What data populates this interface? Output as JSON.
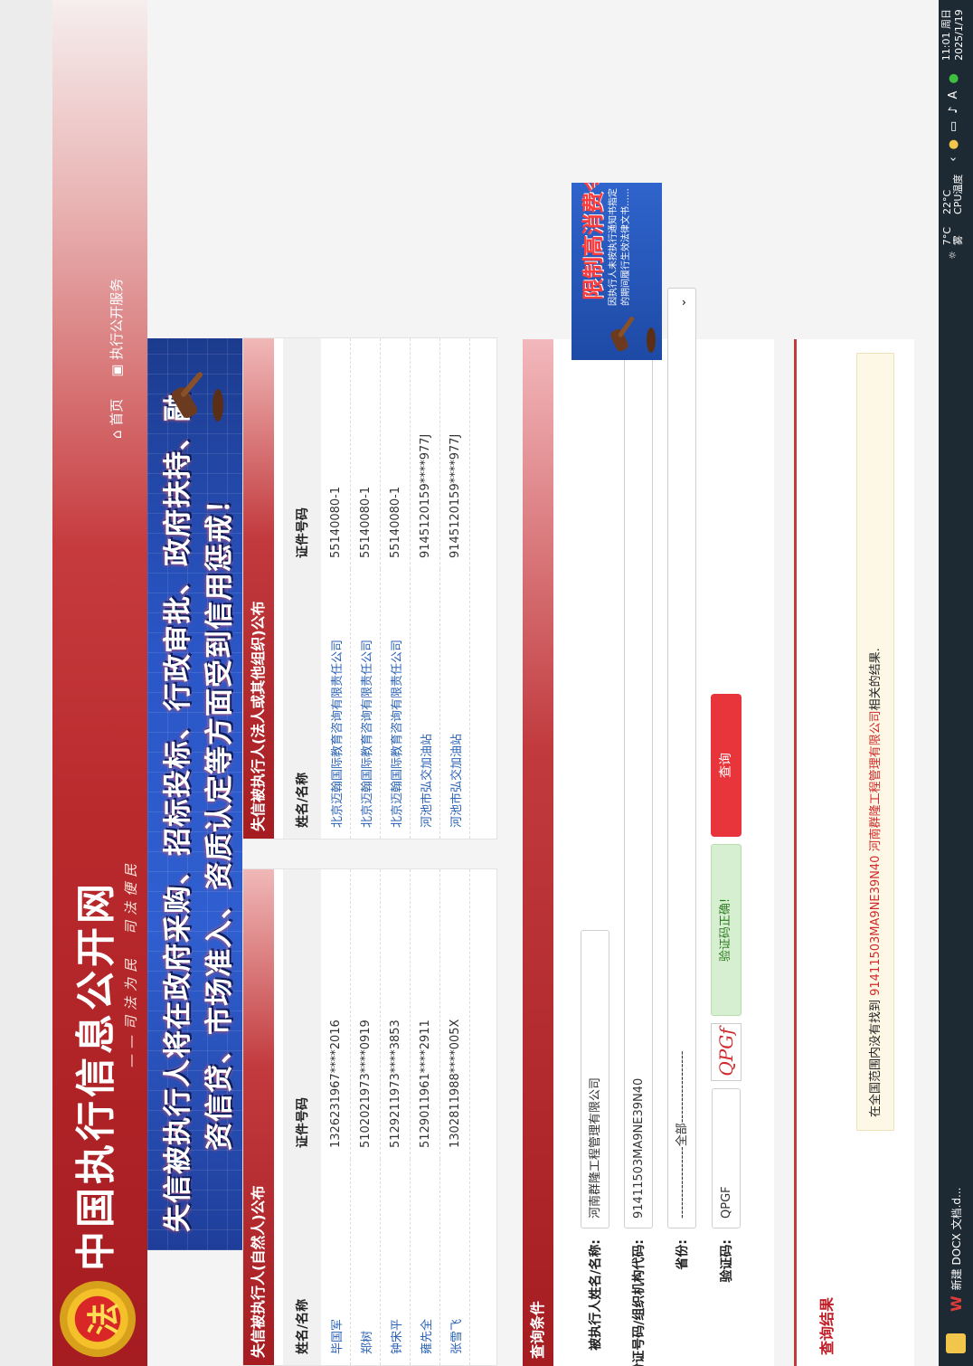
{
  "header": {
    "site_title": "中国执行信息公开网",
    "slogan": "——司法为民　司法便民",
    "nav": {
      "home": "首页",
      "service": "执行公开服务"
    }
  },
  "banner": {
    "line1": "失信被执行人将在政府采购、招标投标、行政审批、政府扶持、融",
    "line2": "资信贷、市场准入、资质认定等方面受到信用惩戒！"
  },
  "person_list": {
    "title": "失信被执行人(自然人)公布",
    "col_name": "姓名/名称",
    "col_id": "证件号码",
    "rows": [
      {
        "name": "毕国军",
        "id": "1326231967****2016"
      },
      {
        "name": "郑树",
        "id": "5102021973****0919"
      },
      {
        "name": "钟宋平",
        "id": "5129211973****3853"
      },
      {
        "name": "雍先全",
        "id": "5129011961****2911"
      },
      {
        "name": "张雪飞",
        "id": "1302811988****005X"
      }
    ]
  },
  "org_list": {
    "title": "失信被执行人(法人或其他组织)公布",
    "col_name": "姓名/名称",
    "col_id": "证件号码",
    "rows": [
      {
        "name": "北京迈翰国际教育咨询有限责任公司",
        "id": "55140080-1"
      },
      {
        "name": "北京迈翰国际教育咨询有限责任公司",
        "id": "55140080-1"
      },
      {
        "name": "北京迈翰国际教育咨询有限责任公司",
        "id": "55140080-1"
      },
      {
        "name": "河池市弘交加油站",
        "id": "9145120159****977J"
      },
      {
        "name": "河池市弘交加油站",
        "id": "9145120159****977J"
      }
    ]
  },
  "query": {
    "title": "查询条件",
    "name_label": "被执行人姓名/名称:",
    "name_value": "河南群隆工程管理有限公司",
    "id_label": "身份证号码/组织机构代码:",
    "id_value": "91411503MA9NE39N40",
    "province_label": "省份:",
    "province_value": "-----------------全部-----------------",
    "captcha_label": "验证码:",
    "captcha_value": "QPGF",
    "captcha_image_text": "QPGf",
    "captcha_ok": "验证码正确!",
    "submit": "查询"
  },
  "result": {
    "title": "查询结果",
    "prefix": "在全国范围内没有找到 ",
    "hit": "91411503MA9NE39N40 河南群隆工程管理有限公司",
    "suffix": "相关的结果."
  },
  "ad": {
    "title": "限制高消费令",
    "text": "因执行人未按执行通知书指定的期间履行生效法律文书……"
  },
  "taskbar": {
    "app": "新建 DOCX 文档.d...",
    "temp_outside": "7°C",
    "weather": "雾",
    "cpu_temp": "22°C",
    "cpu_label": "CPU温度",
    "ime": "A",
    "time": "11:01 周日",
    "date": "2025/1/19"
  },
  "colors": {
    "brand_red": "#a51c21",
    "link_blue": "#2a62b6",
    "button_red": "#e8343b",
    "banner_blue": "#2f5fd0"
  }
}
